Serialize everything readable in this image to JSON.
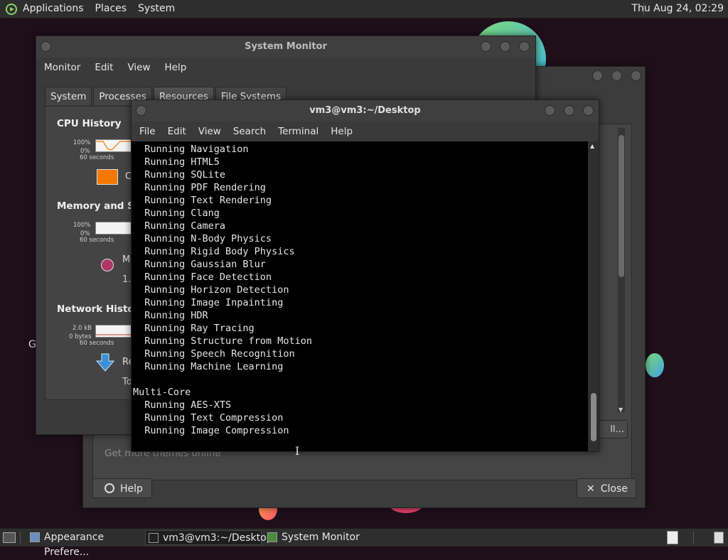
{
  "top_panel": {
    "menus": [
      "Applications",
      "Places",
      "System"
    ],
    "clock": "Thu Aug 24, 02:29"
  },
  "desktop": {
    "partial_label": "G"
  },
  "appearance_window": {
    "install_partial": "ll...",
    "themes_link": "Get more themes online",
    "help_label": "Help",
    "close_label": "Close"
  },
  "system_monitor": {
    "title": "System Monitor",
    "menus": [
      "Monitor",
      "Edit",
      "View",
      "Help"
    ],
    "tabs": [
      "System",
      "Processes",
      "Resources",
      "File Systems"
    ],
    "active_tab": "Resources",
    "cpu": {
      "title": "CPU History",
      "max": "100%",
      "min": "0%",
      "span": "60 seconds",
      "legend_partial": "C",
      "color": "#f57900"
    },
    "memory": {
      "title": "Memory and Swa",
      "max": "100%",
      "min": "0%",
      "span": "60 seconds",
      "legend_partial": "M",
      "value_partial": "1.",
      "color": "#ad3865"
    },
    "network": {
      "title": "Network History",
      "max": "2.0 kB",
      "min": "0 bytes",
      "span": "60 seconds",
      "receiving_partial": "Re",
      "total_partial": "To"
    }
  },
  "terminal": {
    "title": "vm3@vm3:~/Desktop",
    "menus": [
      "File",
      "Edit",
      "View",
      "Search",
      "Terminal",
      "Help"
    ],
    "lines": [
      "  Running Navigation",
      "  Running HTML5",
      "  Running SQLite",
      "  Running PDF Rendering",
      "  Running Text Rendering",
      "  Running Clang",
      "  Running Camera",
      "  Running N-Body Physics",
      "  Running Rigid Body Physics",
      "  Running Gaussian Blur",
      "  Running Face Detection",
      "  Running Horizon Detection",
      "  Running Image Inpainting",
      "  Running HDR",
      "  Running Ray Tracing",
      "  Running Structure from Motion",
      "  Running Speech Recognition",
      "  Running Machine Learning",
      "",
      "Multi-Core",
      "  Running AES-XTS",
      "  Running Text Compression",
      "  Running Image Compression"
    ]
  },
  "taskbar": {
    "items": [
      {
        "label": "Appearance Prefere..."
      },
      {
        "label": "vm3@vm3:~/Desktop"
      },
      {
        "label": "System Monitor"
      }
    ]
  }
}
